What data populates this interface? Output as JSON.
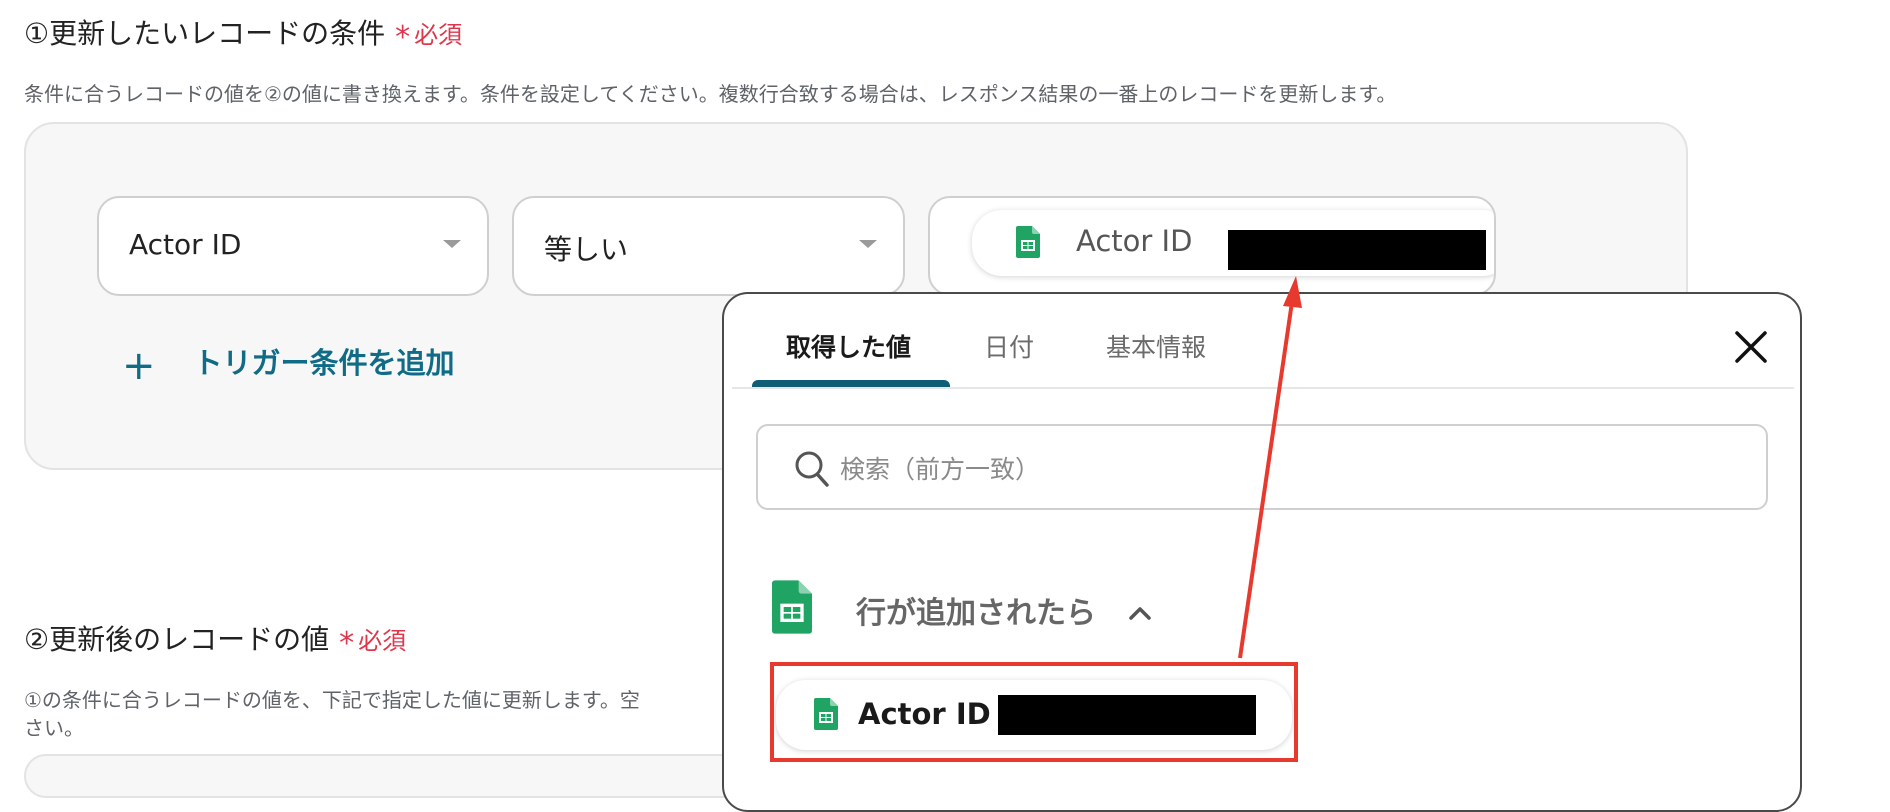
{
  "section1": {
    "title": "①更新したいレコードの条件",
    "required": "必須",
    "description": "条件に合うレコードの値を②の値に書き換えます。条件を設定してください。複数行合致する場合は、レスポンス結果の一番上のレコードを更新します。"
  },
  "condition": {
    "field_value": "Actor ID",
    "operator_value": "等しい",
    "value_chip_label": "Actor ID"
  },
  "add_condition_label": "トリガー条件を追加",
  "section2": {
    "title": "②更新後のレコードの値",
    "required": "必須",
    "description_line1": "①の条件に合うレコードの値を、下記で指定した値に更新します。空",
    "description_line2": "さい。"
  },
  "popup": {
    "tabs": [
      {
        "label": "取得した値",
        "active": true
      },
      {
        "label": "日付",
        "active": false
      },
      {
        "label": "基本情報",
        "active": false
      }
    ],
    "search_placeholder": "検索（前方一致）",
    "group_label": "行が追加されたら",
    "item_label": "Actor ID"
  },
  "icons": {
    "close": "close-icon",
    "search": "search-icon",
    "sheet": "google-sheets-icon",
    "dropdown": "caret-down-icon",
    "collapse": "chevron-up-icon",
    "add": "plus-icon"
  },
  "colors": {
    "accent": "#0f6b86",
    "required": "#e0364b",
    "annotation": "#e8392e",
    "sheets_green": "#1fa463"
  }
}
